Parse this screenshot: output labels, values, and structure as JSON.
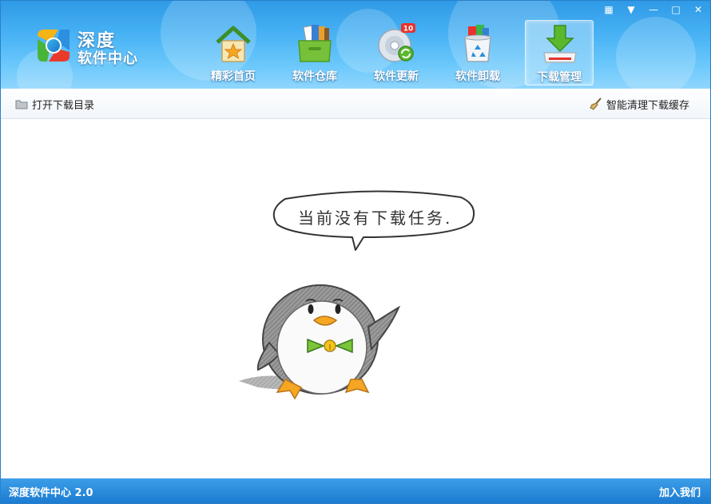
{
  "app": {
    "logo_line1": "深度",
    "logo_line2": "软件中心",
    "version_text": "深度软件中心 2.0",
    "join_us": "加入我们"
  },
  "window_controls": [
    {
      "name": "skin-icon",
      "glyph": "▦"
    },
    {
      "name": "menu-icon",
      "glyph": "▼"
    },
    {
      "name": "minimize-icon",
      "glyph": "—"
    },
    {
      "name": "maximize-icon",
      "glyph": "□"
    },
    {
      "name": "close-icon",
      "glyph": "✕"
    }
  ],
  "nav": {
    "tabs": [
      {
        "label": "精彩首页",
        "icon": "home-icon",
        "active": false
      },
      {
        "label": "软件仓库",
        "icon": "software-repository-icon",
        "active": false
      },
      {
        "label": "软件更新",
        "icon": "software-update-icon",
        "active": false,
        "badge": "10"
      },
      {
        "label": "软件卸载",
        "icon": "uninstall-recycle-icon",
        "active": false
      },
      {
        "label": "下载管理",
        "icon": "download-manager-icon",
        "active": true
      }
    ]
  },
  "toolbar": {
    "open_dir_label": "打开下载目录",
    "clean_cache_label": "智能清理下载缓存"
  },
  "content": {
    "empty_message": "当前没有下载任务."
  },
  "colors": {
    "header_top": "#2f9ae6",
    "header_bottom": "#8fd6fd",
    "statusbar": "#1b7bd1",
    "badge_red": "#e8322b",
    "bowtie_green": "#7cc43a",
    "beak_orange": "#f5a623"
  }
}
